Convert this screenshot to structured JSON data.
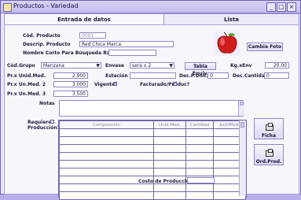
{
  "window": {
    "title": "Productos - Variedad",
    "controls": [
      "_",
      "□",
      "×"
    ]
  },
  "tabs": [
    {
      "label": "Entrada de datos",
      "active": true
    },
    {
      "label": "Lista",
      "active": false
    }
  ],
  "product": {
    "code_label": "Cód. Producto",
    "code_value": "0001",
    "descr_label": "Descrip. Producto",
    "descr_value": "Red Chica Marca",
    "short_name_label": "Nombre Corto Para Búsqueda Rápida",
    "short_name_value": "",
    "change_photo_button": "Cambia Foto"
  },
  "fields": {
    "group_label": "Cód.Grupo",
    "group_value": "Manzana",
    "package_label": "Envase",
    "package_value": "sera x 2",
    "equiv_button": "Tabla Equiv.",
    "kg_label": "Kg.xEnv",
    "kg_value": "20.00",
    "price1_label": "Pr.x Unid.Med.",
    "price1_value": "2.900",
    "season_label": "Estación",
    "season_value": "",
    "decp_label": "Dec.P.Unit.",
    "decp_value": "0",
    "decq_label": "Dec.Cantidad",
    "decq_value": "0",
    "price2_label": "Pr.x Un.Med. 2",
    "price2_value": "3.000",
    "vigente_label": "Vigente",
    "facturado_label": "Facturado/Produc?",
    "price3_label": "Pr.x Un.Med. 3",
    "price3_value": "3.500",
    "notes_label": "Notas",
    "notes_value": "",
    "requires_label_line1": "Requiere",
    "requires_label_line2": "Producción?",
    "cost_label": "Costo de Producción",
    "cost_value": ""
  },
  "table": {
    "headers": [
      "Composición",
      "Unid.Med.",
      "Cantidad",
      "$x/UMed."
    ],
    "rows": 9
  },
  "buttons": {
    "ficha": "Ficha",
    "ord_prod": "Ord.Prod."
  },
  "colors": {
    "window_bg": "#ebe8f6",
    "accent": "#8f87c9",
    "apple_red": "#cf1d1d"
  }
}
